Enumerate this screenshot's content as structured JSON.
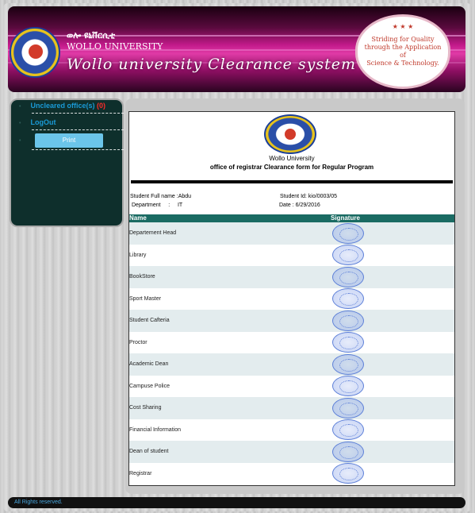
{
  "header": {
    "logo_ring_text": "WOLLO UNIVERSITY",
    "amharic_name": "ወሎ ዩኒቨርሲቲ",
    "university_name": "WOLLO UNIVERSITY",
    "system_title": "Wollo university Clearance system",
    "motto_lines": [
      "Striding for Quality",
      "through the Application",
      "of",
      "Science & Technology."
    ],
    "motto_stars": "★ ★ ★"
  },
  "sidebar": {
    "items": [
      {
        "label": "Uncleared office(s)",
        "count": "(0)"
      },
      {
        "label": "LogOut"
      }
    ],
    "print_label": "Print",
    "bullet": "•"
  },
  "form": {
    "university": "Wollo University",
    "office_title": "office of registrar Clearance form for Regular Program",
    "student_name_text": "Student Full name :Abdu",
    "student_id_text": "Student Id: kio/0003/05",
    "department_text": "Department     :     IT",
    "date_text": "Date : 6/29/2016",
    "columns": {
      "name": "Name",
      "signature": "Signature"
    },
    "rows": [
      "Departement Head",
      "Library",
      "BookStore",
      "Sport Master",
      "Student Cafteria",
      "Proctor",
      "Academic Dean",
      "Campuse Police",
      "Cost Sharing",
      "Financial Information",
      "Dean of student",
      "Registrar"
    ]
  },
  "footer": {
    "text": "All Rights reserved."
  },
  "colors": {
    "banner_accent": "#c21a8a",
    "sidebar_bg": "#0e2f2c",
    "link_blue": "#1a9ad6",
    "count_red": "#ff2a2a",
    "table_header": "#1a6b63",
    "stamp_blue": "#5c7fd8"
  }
}
